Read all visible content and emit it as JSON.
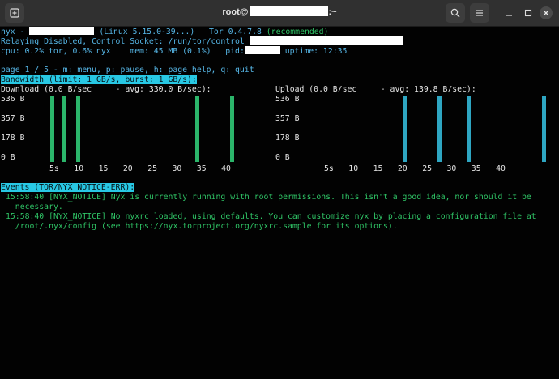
{
  "window": {
    "title_prefix": "root@",
    "title_suffix": ":~"
  },
  "header": {
    "app": "nyx -",
    "system": "(Linux 5.15.0-39...)",
    "tor_version": "Tor 0.4.7.8",
    "tor_status": "(recommended)",
    "relay_status": "Relaying Disabled, Control Socket: /run/tor/control",
    "cpu": "cpu: 0.2% tor, 0.6% nyx",
    "mem": "mem: 45 MB (0.1%)",
    "pid_label": "pid:",
    "uptime": "uptime: 12:35"
  },
  "page_nav": "page 1 / 5 - m: menu, p: pause, h: page help, q: quit",
  "bandwidth": {
    "heading": "Bandwidth (limit: 1 GB/s, burst: 1 GB/s):",
    "download_label": "Download (0.0 B/sec     - avg: 330.0 B/sec):",
    "upload_label": "Upload (0.0 B/sec     - avg: 139.8 B/sec):",
    "y_ticks": [
      "536 B",
      "357 B",
      "178 B",
      "0 B"
    ],
    "x_ticks": [
      "5s",
      "10",
      "15",
      "20",
      "25",
      "30",
      "35",
      "40"
    ],
    "max_value": 536,
    "download_bars": [
      536,
      0,
      0,
      0,
      536,
      0,
      0,
      0,
      0,
      536,
      0,
      0,
      0,
      0,
      0,
      0,
      0,
      0,
      0,
      0,
      0,
      0,
      0,
      0,
      0,
      0,
      0,
      0,
      0,
      0,
      0,
      0,
      0,
      0,
      0,
      0,
      0,
      0,
      0,
      0,
      0,
      0,
      0,
      0,
      0,
      0,
      0,
      0,
      0,
      0,
      536,
      0,
      0,
      0,
      0,
      0,
      0,
      0,
      0,
      0,
      0,
      0,
      536
    ],
    "upload_bars": [
      536,
      0,
      0,
      0,
      0,
      0,
      0,
      0,
      0,
      0,
      0,
      0,
      536,
      0,
      0,
      0,
      0,
      0,
      0,
      0,
      0,
      0,
      536,
      0,
      0,
      0,
      0,
      0,
      0,
      0,
      0,
      0,
      0,
      0,
      0,
      0,
      0,
      0,
      0,
      0,
      0,
      0,
      0,
      0,
      0,
      0,
      0,
      0,
      536
    ]
  },
  "events": {
    "heading": "Events (TOR/NYX NOTICE-ERR):",
    "lines": [
      "15:58:40 [NYX_NOTICE] Nyx is currently running with root permissions. This isn't a good idea, nor should it be",
      "  necessary.",
      "15:58:40 [NYX_NOTICE] No nyxrc loaded, using defaults. You can customize nyx by placing a configuration file at",
      "  /root/.nyx/config (see https://nyx.torproject.org/nyxrc.sample for its options)."
    ]
  },
  "icons": {
    "new_tab": "new-tab-icon",
    "search": "search-icon",
    "menu": "hamburger-menu-icon",
    "close": "close-icon"
  }
}
